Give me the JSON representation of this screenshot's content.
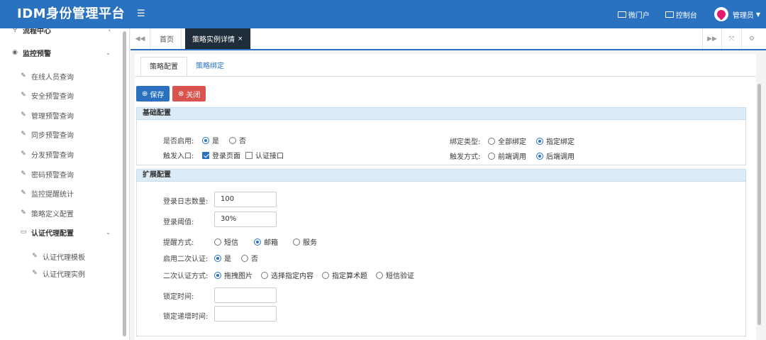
{
  "app": {
    "brand": "IDM身份管理平台",
    "menu_icon": "☰",
    "top_links": [
      {
        "label": "微门户",
        "icon": "id-card-icon"
      },
      {
        "label": "控制台",
        "icon": "monitor-icon"
      }
    ],
    "user": "管理员",
    "brand_color": "#2a72c0"
  },
  "sidebar": {
    "partial_top": "流程中心",
    "group": "监控预警",
    "items": [
      "在线人员查询",
      "安全预警查询",
      "管理预警查询",
      "同步预警查询",
      "分发预警查询",
      "密码预警查询",
      "监控提醒统计",
      "策略定义配置"
    ],
    "sub_group": "认证代理配置",
    "sub_items": [
      "认证代理模板",
      "认证代理实例"
    ]
  },
  "tabs": {
    "home": "首页",
    "active": "策略实例详情",
    "close": "×"
  },
  "inner_tabs": [
    "策略配置",
    "策略绑定"
  ],
  "buttons": {
    "save": "保存",
    "close": "关闭"
  },
  "basic": {
    "title": "基础配置",
    "enable_label": "是否启用:",
    "enable_yes": "是",
    "enable_no": "否",
    "entry_label": "触发入口:",
    "entry_login": "登录页面",
    "entry_auth": "认证接口",
    "bind_type_label": "绑定类型:",
    "bind_all": "全部绑定",
    "bind_specified": "指定绑定",
    "trigger_label": "触发方式:",
    "trigger_pre": "前端调用",
    "trigger_post": "后端调用"
  },
  "extended": {
    "title": "扩展配置",
    "log_count_label": "登录日志数量:",
    "log_count_value": "100",
    "threshold_label": "登录阈值:",
    "threshold_value": "30%",
    "notify_label": "提醒方式:",
    "notify_sms": "短信",
    "notify_mail": "邮箱",
    "notify_service": "服务",
    "second_auth_label": "启用二次认证:",
    "second_yes": "是",
    "second_no": "否",
    "second_method_label": "二次认证方式:",
    "method_drag": "拖拽图片",
    "method_select": "选择指定内容",
    "method_math": "指定算术题",
    "method_sms": "短信验证",
    "lock_time_label": "锁定时间:",
    "lock_time_value": "",
    "lock_inc_label": "锁定递增时间:",
    "lock_inc_value": ""
  }
}
